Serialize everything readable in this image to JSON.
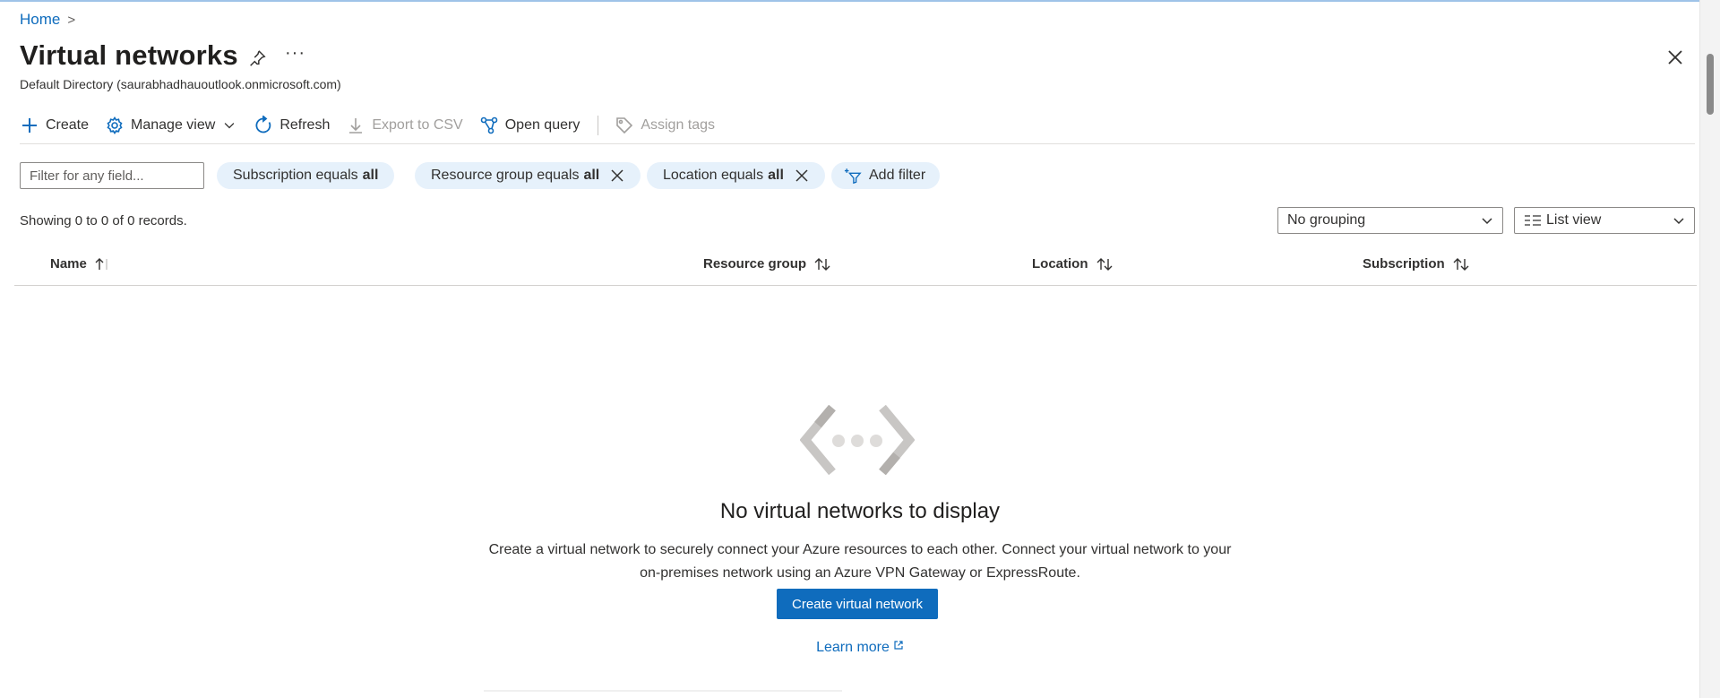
{
  "breadcrumb": {
    "home": "Home",
    "separator": ">"
  },
  "header": {
    "title": "Virtual networks",
    "more": "···",
    "subtitle": "Default Directory (saurabhadhauoutlook.onmicrosoft.com)"
  },
  "toolbar": {
    "create": "Create",
    "manage_view": "Manage view",
    "refresh": "Refresh",
    "export_csv": "Export to CSV",
    "open_query": "Open query",
    "assign_tags": "Assign tags"
  },
  "filters": {
    "placeholder": "Filter for any field...",
    "subscription": {
      "label": "Subscription equals",
      "value": "all"
    },
    "resource_group": {
      "label": "Resource group equals",
      "value": "all"
    },
    "location": {
      "label": "Location equals",
      "value": "all"
    },
    "add_filter": "Add filter"
  },
  "records": "Showing 0 to 0 of 0 records.",
  "grouping": {
    "selected": "No grouping"
  },
  "view": {
    "selected": "List view"
  },
  "table": {
    "columns": [
      "Name",
      "Resource group",
      "Location",
      "Subscription"
    ]
  },
  "empty_state": {
    "title": "No virtual networks to display",
    "description_line1": "Create a virtual network to securely connect your Azure resources to each other. Connect your virtual network to your",
    "description_line2": "on-premises network using an Azure VPN Gateway or ExpressRoute.",
    "button": "Create virtual network",
    "learn_more": "Learn more"
  },
  "colors": {
    "accent": "#0f6cbd",
    "pill_bg": "#e6f1fb",
    "text": "#323130"
  }
}
